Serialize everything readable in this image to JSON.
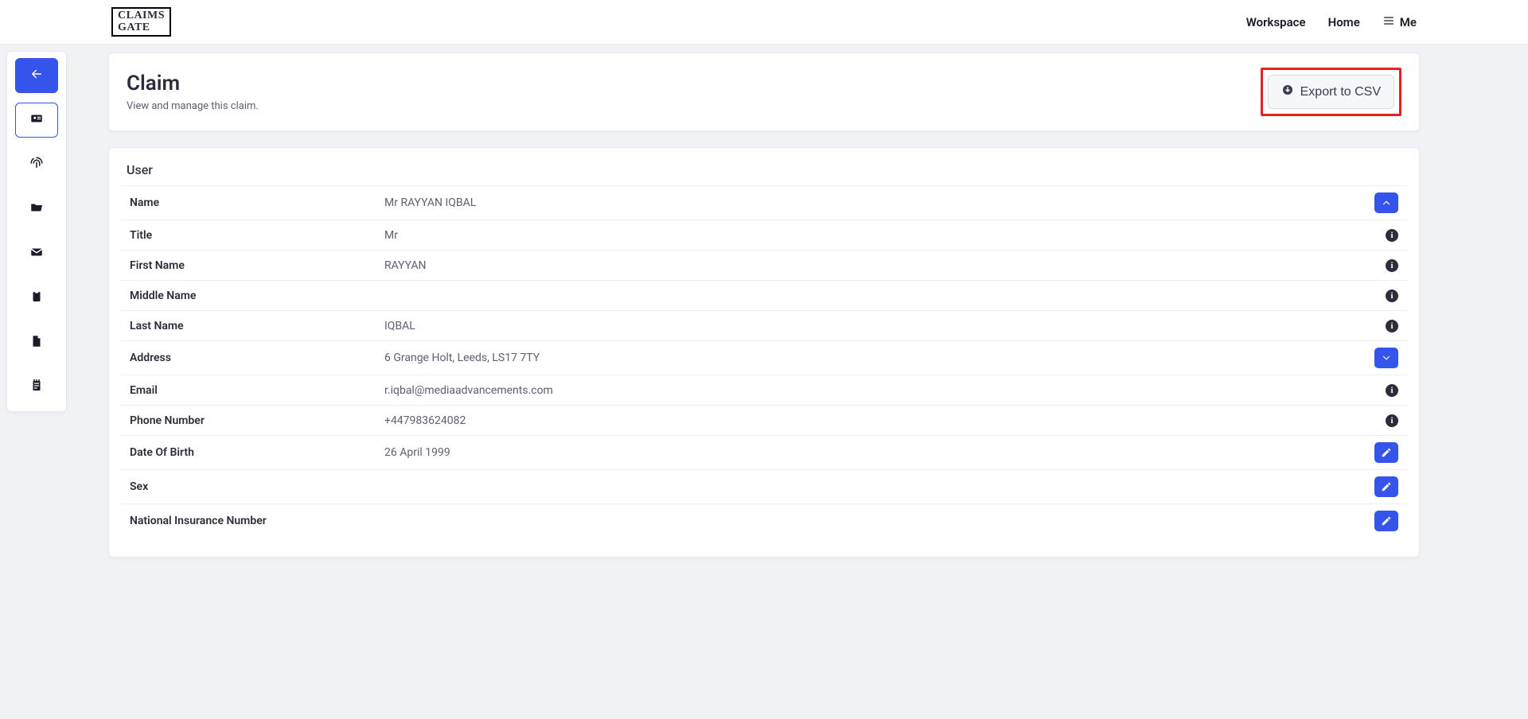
{
  "brand": {
    "line1": "CLAIMS",
    "line2": "GATE"
  },
  "nav": {
    "workspace": "Workspace",
    "home": "Home",
    "me": "Me"
  },
  "header": {
    "title": "Claim",
    "subtitle": "View and manage this claim.",
    "export_label": "Export to CSV",
    "export_highlight": true
  },
  "user_section": {
    "title": "User",
    "rows": [
      {
        "label": "Name",
        "value": "Mr RAYYAN IQBAL",
        "action": "collapse"
      },
      {
        "label": "Title",
        "value": "Mr",
        "action": "info"
      },
      {
        "label": "First Name",
        "value": "RAYYAN",
        "action": "info"
      },
      {
        "label": "Middle Name",
        "value": "",
        "action": "info"
      },
      {
        "label": "Last Name",
        "value": "IQBAL",
        "action": "info"
      },
      {
        "label": "Address",
        "value": "6 Grange Holt, Leeds, LS17 7TY",
        "action": "expand"
      },
      {
        "label": "Email",
        "value": "r.iqbal@mediaadvancements.com",
        "action": "info"
      },
      {
        "label": "Phone Number",
        "value": "+447983624082",
        "action": "info"
      },
      {
        "label": "Date Of Birth",
        "value": "26 April 1999",
        "action": "edit"
      },
      {
        "label": "Sex",
        "value": "",
        "action": "edit"
      },
      {
        "label": "National Insurance Number",
        "value": "",
        "action": "edit"
      }
    ]
  },
  "sidebar": {
    "items": [
      {
        "name": "back",
        "primary": true
      },
      {
        "name": "id-card",
        "active": true
      },
      {
        "name": "fingerprint"
      },
      {
        "name": "folder"
      },
      {
        "name": "mail"
      },
      {
        "name": "clipboard"
      },
      {
        "name": "file"
      },
      {
        "name": "notes"
      }
    ]
  }
}
